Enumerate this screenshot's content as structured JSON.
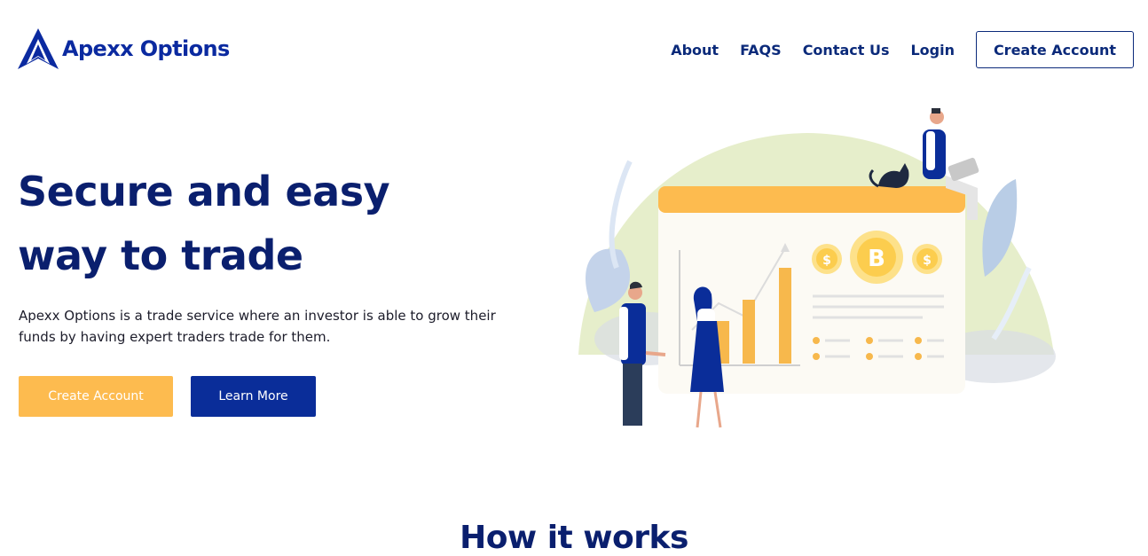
{
  "header": {
    "brand": "Apexx Options",
    "nav": [
      {
        "label": "About"
      },
      {
        "label": "FAQS"
      },
      {
        "label": "Contact Us"
      },
      {
        "label": "Login"
      }
    ],
    "cta_label": "Create Account"
  },
  "hero": {
    "title_line1": "Secure and easy",
    "title_line2": "way to trade",
    "description": "Apexx Options is a trade service where an investor is able to grow their funds by having expert traders trade for them.",
    "primary_button": "Create Account",
    "secondary_button": "Learn More",
    "illustration": {
      "coin_center_symbol": "B",
      "coin_side_symbol": "$"
    }
  },
  "sections": {
    "how_it_works_title": "How it works"
  },
  "colors": {
    "navy": "#0a1f6e",
    "brand_blue": "#0b2aa0",
    "accent_orange": "#fdbb4f",
    "button_blue": "#0a2d99"
  }
}
